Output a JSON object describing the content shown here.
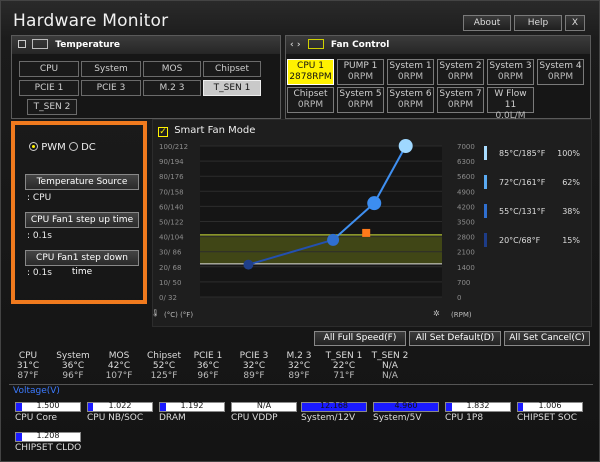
{
  "app_title": "Hardware Monitor",
  "window_buttons": [
    "About",
    "Help",
    "X"
  ],
  "temperature": {
    "header": "Temperature",
    "sources": [
      "CPU",
      "System",
      "MOS",
      "Chipset",
      "PCIE 1",
      "PCIE 3",
      "M.2 3",
      "T_SEN 1",
      "T_SEN 2"
    ],
    "selected": "T_SEN 1"
  },
  "fan_control": {
    "header": "Fan Control",
    "fans": [
      {
        "name": "CPU 1",
        "rpm": "2878RPM"
      },
      {
        "name": "PUMP 1",
        "rpm": "0RPM"
      },
      {
        "name": "System 1",
        "rpm": "0RPM"
      },
      {
        "name": "System 2",
        "rpm": "0RPM"
      },
      {
        "name": "System 3",
        "rpm": "0RPM"
      },
      {
        "name": "System 4",
        "rpm": "0RPM"
      },
      {
        "name": "Chipset",
        "rpm": "0RPM"
      },
      {
        "name": "System 5",
        "rpm": "0RPM"
      },
      {
        "name": "System 6",
        "rpm": "0RPM"
      },
      {
        "name": "System 7",
        "rpm": "0RPM"
      },
      {
        "name": "W Flow 11",
        "rpm": "0.0L/M"
      }
    ],
    "selected": "CPU 1"
  },
  "left_settings": {
    "mode_pwm": "PWM",
    "mode_dc": "DC",
    "temp_source_label": "Temperature Source",
    "temp_source_value": ": CPU",
    "step_up_label": "CPU Fan1 step up time",
    "step_up_value": ": 0.1s",
    "step_down_label": "CPU Fan1 step down time",
    "step_down_value": ": 0.1s"
  },
  "smart_fan": {
    "label": "Smart Fan Mode",
    "checked": true
  },
  "chart_data": {
    "type": "line",
    "left_ticks": [
      "100/212",
      "90/194",
      "80/176",
      "70/158",
      "60/140",
      "50/122",
      "40/104",
      "30/ 86",
      "20/ 68",
      "10/ 50",
      "0/ 32"
    ],
    "right_ticks": [
      "7000",
      "6300",
      "5600",
      "4900",
      "4200",
      "3500",
      "2800",
      "2100",
      "1400",
      "700",
      "0"
    ],
    "left_unit": "(°C) (°F)",
    "right_unit": "(RPM)",
    "x_range": [
      0,
      100
    ],
    "y_range": [
      0,
      7000
    ],
    "fan_curve": [
      {
        "temp": 20,
        "rpm": 1500
      },
      {
        "temp": 55,
        "rpm": 2650
      },
      {
        "temp": 72,
        "rpm": 4350
      },
      {
        "temp": 85,
        "rpm": 7000
      }
    ],
    "current": {
      "temp": 60,
      "rpm": 2878
    },
    "legend": [
      {
        "label": "85°C/185°F",
        "percent": "100%"
      },
      {
        "label": "72°C/161°F",
        "percent": "62%"
      },
      {
        "label": "55°C/131°F",
        "percent": "38%"
      },
      {
        "label": "20°C/68°F",
        "percent": "15%"
      }
    ]
  },
  "actions": {
    "full_speed": "All Full Speed(F)",
    "set_default": "All Set Default(D)",
    "set_cancel": "All Set Cancel(C)"
  },
  "temp_readings": [
    {
      "name": "CPU",
      "c": "31°C",
      "f": "87°F"
    },
    {
      "name": "System",
      "c": "36°C",
      "f": "96°F"
    },
    {
      "name": "MOS",
      "c": "42°C",
      "f": "107°F"
    },
    {
      "name": "Chipset",
      "c": "52°C",
      "f": "125°F"
    },
    {
      "name": "PCIE 1",
      "c": "36°C",
      "f": "96°F"
    },
    {
      "name": "PCIE 3",
      "c": "32°C",
      "f": "89°F"
    },
    {
      "name": "M.2 3",
      "c": "32°C",
      "f": "89°F"
    },
    {
      "name": "T_SEN 1",
      "c": "22°C",
      "f": "71°F"
    },
    {
      "name": "T_SEN 2",
      "c": "N/A",
      "f": "N/A"
    }
  ],
  "voltage": {
    "header": "Voltage(V)",
    "items": [
      {
        "name": "CPU Core",
        "value": "1.500",
        "fill": 0.1
      },
      {
        "name": "CPU NB/SOC",
        "value": "1.022",
        "fill": 0.08
      },
      {
        "name": "DRAM",
        "value": "1.192",
        "fill": 0.09
      },
      {
        "name": "CPU VDDP",
        "value": "N/A",
        "fill": 0.0
      },
      {
        "name": "System/12V",
        "value": "12.168",
        "fill": 1.0
      },
      {
        "name": "System/5V",
        "value": "4.960",
        "fill": 1.0
      },
      {
        "name": "CPU 1P8",
        "value": "1.832",
        "fill": 0.1
      },
      {
        "name": "CHIPSET SOC",
        "value": "1.006",
        "fill": 0.08
      },
      {
        "name": "CHIPSET CLDO",
        "value": "1.208",
        "fill": 0.1
      }
    ]
  }
}
